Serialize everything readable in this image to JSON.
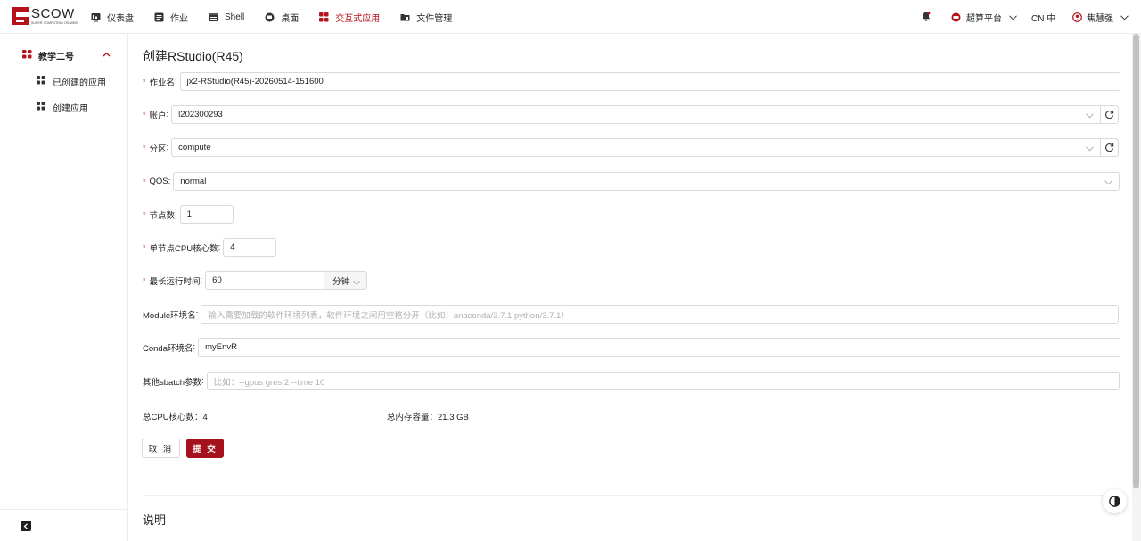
{
  "app": {
    "logo_text": "SCOW",
    "logo_subtext": "SUPER COMPUTING ON WEB"
  },
  "nav": {
    "items": [
      {
        "label": "仪表盘",
        "icon": "dashboard-icon"
      },
      {
        "label": "作业",
        "icon": "job-icon"
      },
      {
        "label": "Shell",
        "icon": "terminal-icon"
      },
      {
        "label": "桌面",
        "icon": "desktop-icon"
      },
      {
        "label": "交互式应用",
        "icon": "apps-icon"
      },
      {
        "label": "文件管理",
        "icon": "folder-icon"
      }
    ],
    "active_index": 4
  },
  "header_right": {
    "platform_label": "超算平台",
    "lang_label": "CN 中",
    "user_name": "焦慧强"
  },
  "sidebar": {
    "group_label": "教学二号",
    "items": [
      {
        "label": "已创建的应用"
      },
      {
        "label": "创建应用"
      }
    ]
  },
  "form": {
    "title": "创建RStudio(R45)",
    "job_name": {
      "label": "作业名",
      "value": "jx2-RStudio(R45)-20260514-151600"
    },
    "account": {
      "label": "账户",
      "value": "l202300293"
    },
    "partition": {
      "label": "分区",
      "value": "compute"
    },
    "qos": {
      "label": "QOS",
      "value": "normal"
    },
    "nodes": {
      "label": "节点数",
      "value": "1"
    },
    "cpu_cores": {
      "label": "单节点CPU核心数",
      "value": "4"
    },
    "max_time": {
      "label": "最长运行时间",
      "value": "60",
      "unit": "分钟"
    },
    "module_env": {
      "label": "Module环境名",
      "placeholder": "输入需要加载的软件环境列表，软件环境之间用空格分开（比如：anaconda/3.7.1 python/3.7.1）"
    },
    "conda_env": {
      "label": "Conda环境名",
      "value": "myEnvR"
    },
    "sbatch": {
      "label": "其他sbatch参数",
      "placeholder": "比如：--gpus gres:2 --time 10"
    },
    "total_cpu": "总CPU核心数：4",
    "total_mem": "总内存容量：21.3 GB",
    "cancel_label": "取 消",
    "submit_label": "提 交"
  },
  "description_title": "说明",
  "colors": {
    "brand": "#b5121b",
    "submit": "#a5121b",
    "required": "#d4262e"
  }
}
